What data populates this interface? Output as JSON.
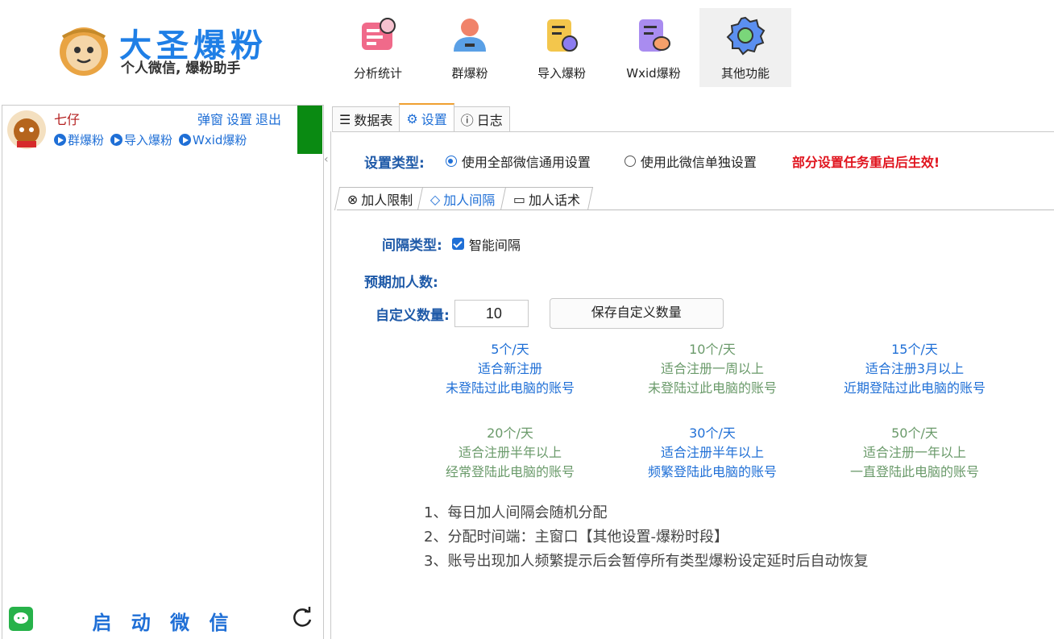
{
  "brand": {
    "title": "大圣爆粉",
    "subtitle": "个人微信, 爆粉助手"
  },
  "toolbar": [
    {
      "label": "分析统计",
      "icon": "chart-board-icon"
    },
    {
      "label": "群爆粉",
      "icon": "user-group-icon"
    },
    {
      "label": "导入爆粉",
      "icon": "import-doc-icon"
    },
    {
      "label": "Wxid爆粉",
      "icon": "wxid-chat-icon"
    },
    {
      "label": "其他功能",
      "icon": "gear-icon"
    }
  ],
  "account": {
    "name": "七仔",
    "links": [
      "弹窗",
      "设置",
      "退出"
    ],
    "actions": [
      "群爆粉",
      "导入爆粉",
      "Wxid爆粉"
    ],
    "status_color": "#0a8a12"
  },
  "left_bottom": {
    "start_label": "启 动 微 信"
  },
  "tabs": [
    {
      "label": "数据表",
      "icon": "list-icon"
    },
    {
      "label": "设置",
      "icon": "gear-icon"
    },
    {
      "label": "日志",
      "icon": "info-icon"
    }
  ],
  "settings": {
    "type_label": "设置类型:",
    "radio_global": "使用全部微信通用设置",
    "radio_single": "使用此微信单独设置",
    "warning": "部分设置任务重启后生效!"
  },
  "subtabs": [
    {
      "label": "加人限制"
    },
    {
      "label": "加人间隔"
    },
    {
      "label": "加人话术"
    }
  ],
  "interval": {
    "type_label": "间隔类型:",
    "smart_label": "智能间隔",
    "smart_checked": true,
    "expected_label": "预期加人数:",
    "custom_label": "自定义数量:",
    "custom_value": "10",
    "save_label": "保存自定义数量"
  },
  "options": [
    {
      "rate": "5个/天",
      "l1": "适合新注册",
      "l2": "未登陆过此电脑的账号",
      "color": "blue"
    },
    {
      "rate": "10个/天",
      "l1": "适合注册一周以上",
      "l2": "未登陆过此电脑的账号",
      "color": "green"
    },
    {
      "rate": "15个/天",
      "l1": "适合注册3月以上",
      "l2": "近期登陆过此电脑的账号",
      "color": "blue"
    },
    {
      "rate": "20个/天",
      "l1": "适合注册半年以上",
      "l2": "经常登陆此电脑的账号",
      "color": "green"
    },
    {
      "rate": "30个/天",
      "l1": "适合注册半年以上",
      "l2": "频繁登陆此电脑的账号",
      "color": "blue"
    },
    {
      "rate": "50个/天",
      "l1": "适合注册一年以上",
      "l2": "一直登陆此电脑的账号",
      "color": "green"
    }
  ],
  "notes": [
    "1、每日加人间隔会随机分配",
    "2、分配时间端：主窗口【其他设置-爆粉时段】",
    "3、账号出现加人频繁提示后会暂停所有类型爆粉设定延时后自动恢复"
  ]
}
